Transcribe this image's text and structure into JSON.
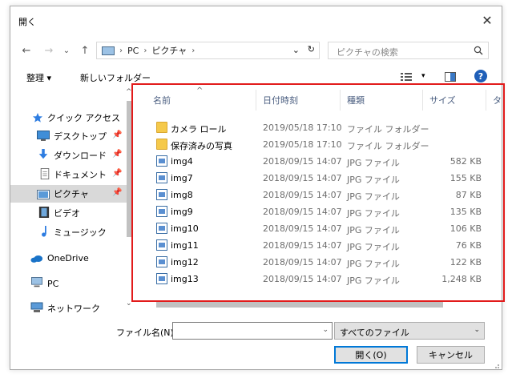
{
  "window": {
    "title": "開く",
    "close_glyph": "✕"
  },
  "nav": {
    "back": "←",
    "forward": "→",
    "recent": "⌄",
    "up": "↑",
    "address": [
      "PC",
      "ピクチャ"
    ],
    "address_sep": "›",
    "search_placeholder": "ピクチャの検索"
  },
  "toolbar": {
    "organize_label": "整理",
    "organize_caret": "▾",
    "new_folder_label": "新しいフォルダー",
    "help_label": "?"
  },
  "sidebar": {
    "items": [
      {
        "label": "クイック アクセス",
        "icon": "star-icon",
        "pinned": false,
        "selected": false
      },
      {
        "label": "デスクトップ",
        "icon": "desktop-icon",
        "pinned": true,
        "selected": false
      },
      {
        "label": "ダウンロード",
        "icon": "download-icon",
        "pinned": true,
        "selected": false
      },
      {
        "label": "ドキュメント",
        "icon": "document-icon",
        "pinned": true,
        "selected": false
      },
      {
        "label": "ピクチャ",
        "icon": "pictures-icon",
        "pinned": true,
        "selected": true
      },
      {
        "label": "ビデオ",
        "icon": "video-icon",
        "pinned": false,
        "selected": false
      },
      {
        "label": "ミュージック",
        "icon": "music-icon",
        "pinned": false,
        "selected": false
      },
      {
        "label": "OneDrive",
        "icon": "cloud-icon",
        "pinned": false,
        "selected": false
      },
      {
        "label": "PC",
        "icon": "computer-icon",
        "pinned": false,
        "selected": false
      },
      {
        "label": "ネットワーク",
        "icon": "network-icon",
        "pinned": false,
        "selected": false
      }
    ],
    "pin_glyph": "📌"
  },
  "columns": [
    "名前",
    "日付時刻",
    "種類",
    "サイズ",
    "タ"
  ],
  "sort_caret": "^",
  "files": [
    {
      "name": "カメラ ロール",
      "date": "2019/05/18 17:10",
      "type": "ファイル フォルダー",
      "size": "",
      "kind": "folder"
    },
    {
      "name": "保存済みの写真",
      "date": "2019/05/18 17:10",
      "type": "ファイル フォルダー",
      "size": "",
      "kind": "folder"
    },
    {
      "name": "img4",
      "date": "2018/09/15 14:07",
      "type": "JPG ファイル",
      "size": "582 KB",
      "kind": "jpg"
    },
    {
      "name": "img7",
      "date": "2018/09/15 14:07",
      "type": "JPG ファイル",
      "size": "155 KB",
      "kind": "jpg"
    },
    {
      "name": "img8",
      "date": "2018/09/15 14:07",
      "type": "JPG ファイル",
      "size": "87 KB",
      "kind": "jpg"
    },
    {
      "name": "img9",
      "date": "2018/09/15 14:07",
      "type": "JPG ファイル",
      "size": "135 KB",
      "kind": "jpg"
    },
    {
      "name": "img10",
      "date": "2018/09/15 14:07",
      "type": "JPG ファイル",
      "size": "106 KB",
      "kind": "jpg"
    },
    {
      "name": "img11",
      "date": "2018/09/15 14:07",
      "type": "JPG ファイル",
      "size": "76 KB",
      "kind": "jpg"
    },
    {
      "name": "img12",
      "date": "2018/09/15 14:07",
      "type": "JPG ファイル",
      "size": "122 KB",
      "kind": "jpg"
    },
    {
      "name": "img13",
      "date": "2018/09/15 14:07",
      "type": "JPG ファイル",
      "size": "1,248 KB",
      "kind": "jpg"
    }
  ],
  "bottom": {
    "filename_label": "ファイル名(N):",
    "filename_value": "",
    "filter_value": "すべてのファイル",
    "open_label": "開く(O)",
    "cancel_label": "キャンセル",
    "dropdown_glyph": "⌄"
  },
  "colors": {
    "highlight": "#e21b1b",
    "accent": "#0078d7",
    "header_text": "#4d6082"
  }
}
